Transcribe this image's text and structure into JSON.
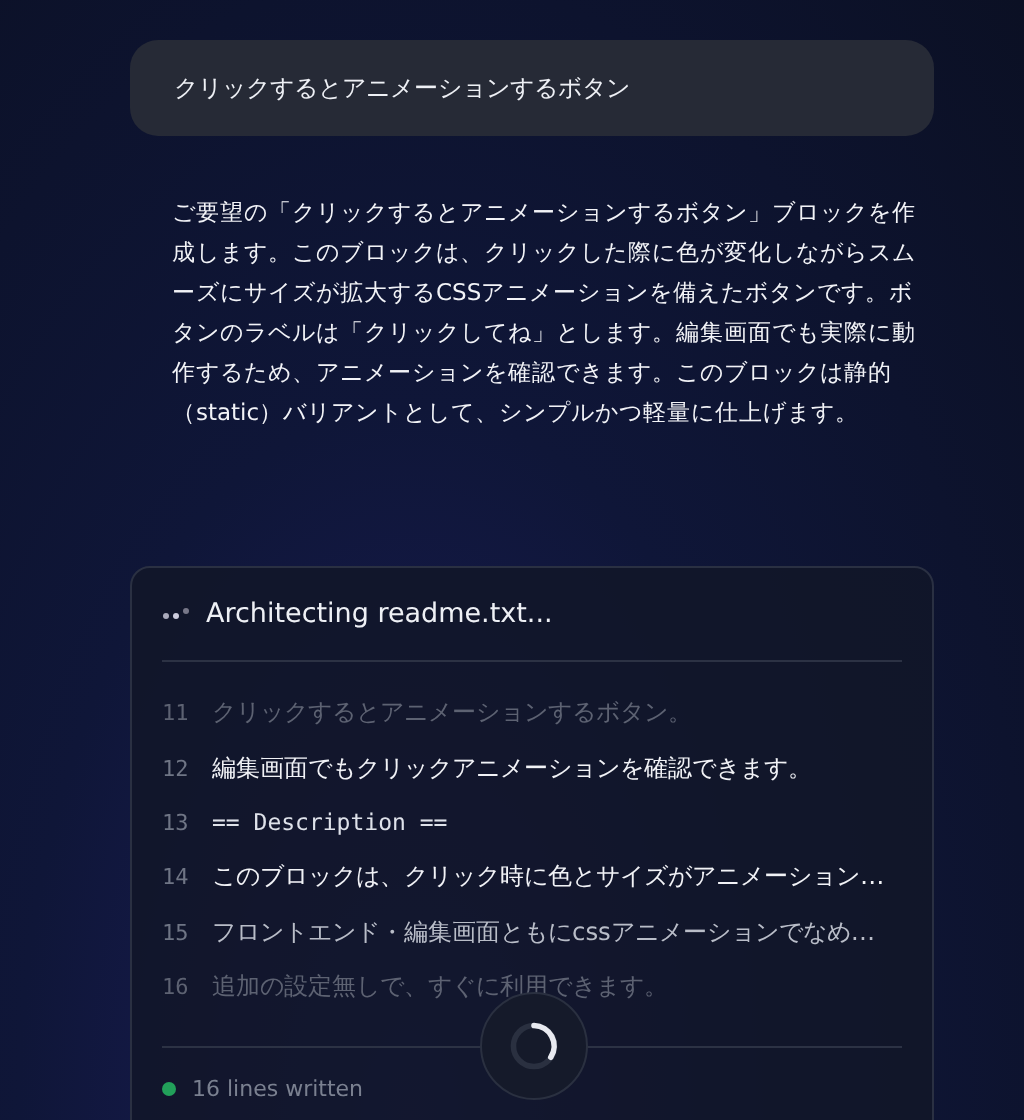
{
  "prompt": {
    "text": "クリックするとアニメーションするボタン"
  },
  "response": {
    "text": "ご要望の「クリックするとアニメーションするボタン」ブロックを作成します。このブロックは、クリックした際に色が変化しながらスムーズにサイズが拡大するCSSアニメーションを備えたボタンです。ボタンのラベルは「クリックしてね」とします。編集画面でも実際に動作するため、アニメーションを確認できます。このブロックは静的（static）バリアントとして、シンプルかつ軽量に仕上げます。"
  },
  "writer": {
    "title": "Architecting readme.txt...",
    "lines": [
      {
        "number": "11",
        "text": "クリックするとアニメーションするボタン。",
        "kind": "text"
      },
      {
        "number": "12",
        "text": "編集画面でもクリックアニメーションを確認できます。",
        "kind": "text"
      },
      {
        "number": "13",
        "text": "== Description ==",
        "kind": "code"
      },
      {
        "number": "14",
        "text": "このブロックは、クリック時に色とサイズがアニメーション…",
        "kind": "text"
      },
      {
        "number": "15",
        "text": "フロントエンド・編集画面ともにcssアニメーションでなめ…",
        "kind": "text"
      },
      {
        "number": "16",
        "text": "追加の設定無しで、すぐに利用できます。",
        "kind": "text"
      }
    ],
    "status": {
      "text": "16 lines written",
      "color": "#22a05a"
    }
  }
}
